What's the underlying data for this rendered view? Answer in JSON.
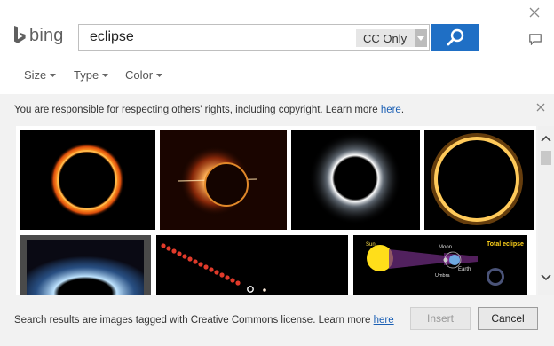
{
  "header": {
    "brand": "bing",
    "search_value": "eclipse",
    "license_filter": "CC Only"
  },
  "filters": [
    {
      "label": "Size"
    },
    {
      "label": "Type"
    },
    {
      "label": "Color"
    }
  ],
  "notice": {
    "text": "You are responsible for respecting others' rights, including copyright. Learn more ",
    "link": "here",
    "suffix": "."
  },
  "results": [
    {
      "label": "Total eclipse",
      "sun_label": "Sun",
      "moon_label": "Moon",
      "earth_label": "Earth",
      "umbra_label": "Umbra"
    }
  ],
  "footer": {
    "text": "Search results are images tagged with Creative Commons license. Learn more ",
    "link": "here",
    "insert_label": "Insert",
    "cancel_label": "Cancel"
  },
  "colors": {
    "accent": "#1f6fc5",
    "link": "#1a5fb4",
    "panel": "#f2f2f2"
  }
}
